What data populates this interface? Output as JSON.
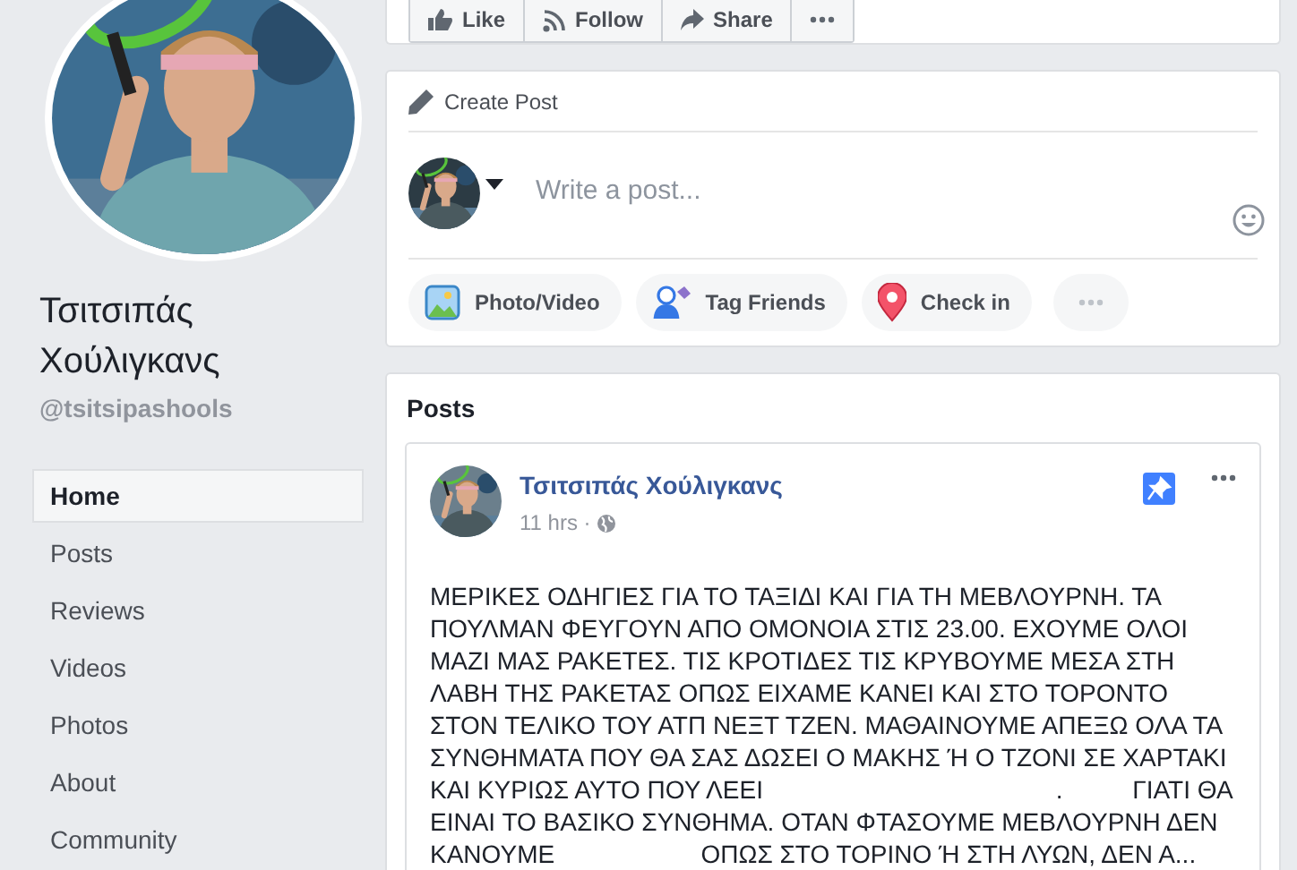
{
  "page": {
    "name": "Τσιτσιπάς Χούλιγκανς",
    "handle": "@tsitsipashools"
  },
  "nav": [
    {
      "label": "Home",
      "selected": true
    },
    {
      "label": "Posts",
      "selected": false
    },
    {
      "label": "Reviews",
      "selected": false
    },
    {
      "label": "Videos",
      "selected": false
    },
    {
      "label": "Photos",
      "selected": false
    },
    {
      "label": "About",
      "selected": false
    },
    {
      "label": "Community",
      "selected": false
    }
  ],
  "actions": [
    {
      "kind": "like",
      "label": "Like"
    },
    {
      "kind": "follow",
      "label": "Follow"
    },
    {
      "kind": "share",
      "label": "Share"
    },
    {
      "kind": "more"
    }
  ],
  "composer": {
    "title": "Create Post",
    "placeholder": "Write a post...",
    "options": [
      {
        "label": "Photo/Video"
      },
      {
        "kind": "tag",
        "label": "Tag Friends"
      },
      {
        "kind": "checkin",
        "label": "Check in"
      },
      {
        "kind": "more"
      }
    ]
  },
  "feed": {
    "title": "Posts",
    "posts": [
      {
        "author": "Τσιτσιπάς Χούλιγκανς",
        "time": "11 hrs ·",
        "pinned": true,
        "text": "ΜΕΡΙΚΕΣ ΟΔΗΓΙΕΣ ΓΙΑ ΤΟ ΤΑΞΙΔΙ ΚΑΙ ΓΙΑ ΤΗ ΜΕΒΛΟΥΡΝΗ. ΤΑ\nΠΟΥΛΜΑΝ ΦΕΥΓΟΥΝ ΑΠΟ ΟΜΟΝΟΙΑ ΣΤΙΣ 23.00. ΕΧΟΥΜΕ ΟΛΟΙ\nΜΑΖΙ ΜΑΣ ΡΑΚΕΤΕΣ. ΤΙΣ ΚΡΟΤΙΔΕΣ ΤΙΣ ΚΡΥΒΟΥΜΕ ΜΕΣΑ ΣΤΗ\nΛΑΒΗ ΤΗΣ ΡΑΚΕΤΑΣ ΟΠΩΣ ΕΙΧΑΜΕ ΚΑΝΕΙ ΚΑΙ ΣΤΟ ΤΟΡΟΝΤΟ\nΣΤΟΝ ΤΕΛΙΚΟ ΤΟΥ ΑΤΠ ΝΕΞΤ ΤΖΕΝ. ΜΑΘΑΙΝΟΥΜΕ ΑΠΕΞΩ ΟΛΑ ΤΑ\nΣΥΝΘΗΜΑΤΑ ΠΟΥ ΘΑ ΣΑΣ ΔΩΣΕΙ Ο ΜΑΚΗΣ Ή Ο ΤΖΟΝΙ ΣΕ ΧΑΡΤΑΚΙ\nΚΑΙ ΚΥΡΙΩΣ ΑΥΤΟ ΠΟΥ ΛΕΕΙ                                          .          ΓΙΑΤΙ ΘΑ\nΕΙΝΑΙ ΤΟ ΒΑΣΙΚΟ ΣΥΝΘΗΜΑ. ΟΤΑΝ ΦΤΑΣΟΥΜΕ ΜΕΒΛΟΥΡΝΗ ΔΕΝ\nΚΑΝΟΥΜΕ                     ΟΠΩΣ ΣΤΟ ΤΟΡΙΝΟ Ή ΣΤΗ ΛΥΩΝ, ΔΕΝ Α..."
      }
    ]
  }
}
